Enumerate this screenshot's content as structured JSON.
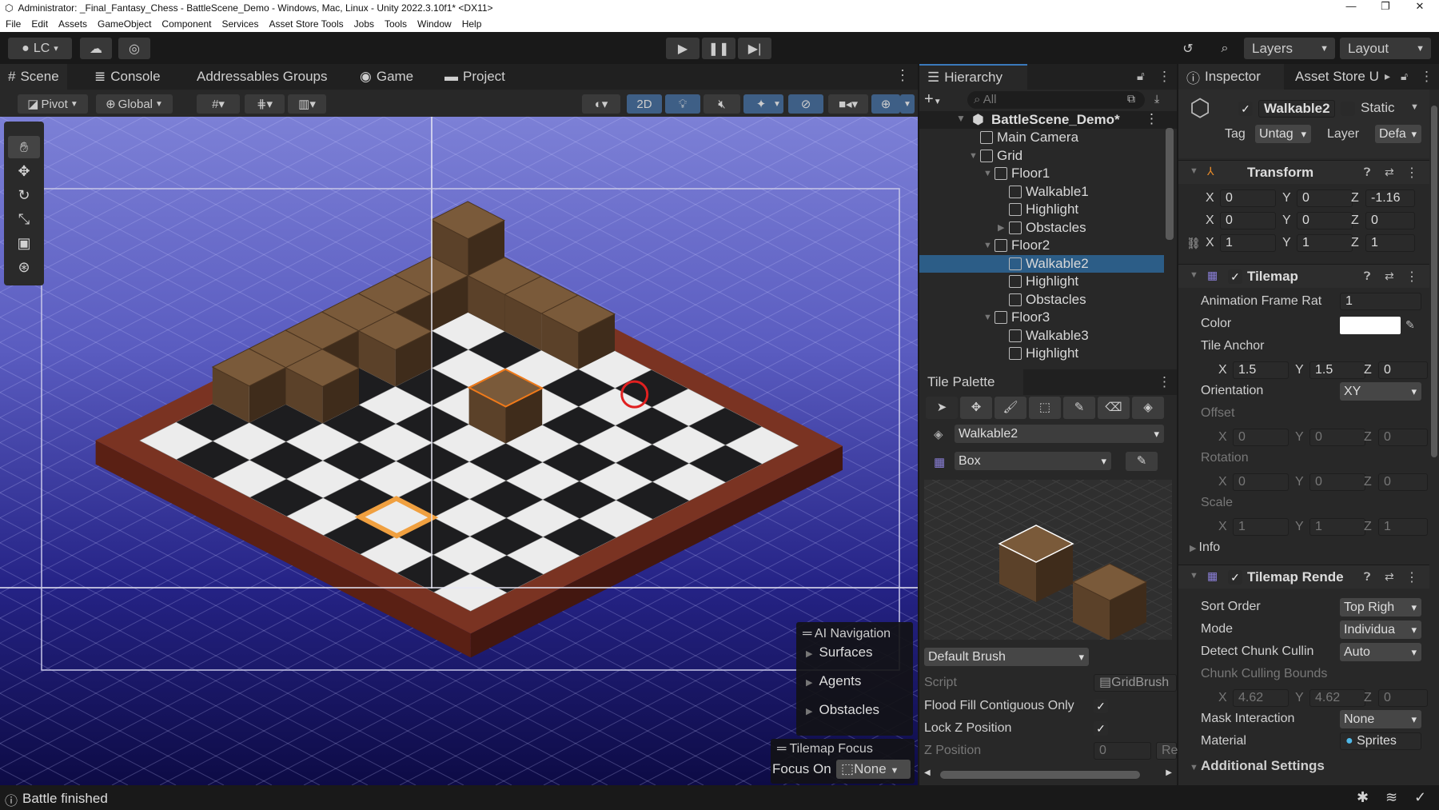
{
  "window": {
    "title": "Administrator: _Final_Fantasy_Chess - BattleScene_Demo - Windows, Mac, Linux - Unity 2022.3.10f1* <DX11>"
  },
  "menu": [
    "File",
    "Edit",
    "Assets",
    "GameObject",
    "Component",
    "Services",
    "Asset Store Tools",
    "Jobs",
    "Tools",
    "Window",
    "Help"
  ],
  "toolbar": {
    "account": "LC",
    "layers": "Layers",
    "layout": "Layout"
  },
  "scene_tabs": [
    {
      "label": "Scene",
      "icon": "#"
    },
    {
      "label": "Console",
      "icon": "≣"
    },
    {
      "label": "Addressables Groups",
      "icon": ""
    },
    {
      "label": "Game",
      "icon": "◉"
    },
    {
      "label": "Project",
      "icon": "▬"
    }
  ],
  "scene_toolbar": {
    "pivot": "Pivot",
    "global": "Global",
    "mode2d": "2D"
  },
  "overlays": {
    "ai_nav_title": "AI Navigation",
    "ai_nav_items": [
      "Surfaces",
      "Agents",
      "Obstacles"
    ],
    "focus_title": "Tilemap Focus",
    "focus_label": "Focus On",
    "focus_value": "None"
  },
  "hierarchy": {
    "title": "Hierarchy",
    "search_placeholder": "All",
    "scene": "BattleScene_Demo*",
    "items": [
      {
        "label": "Main Camera",
        "depth": 1,
        "arrow": ""
      },
      {
        "label": "Grid",
        "depth": 1,
        "arrow": "▼"
      },
      {
        "label": "Floor1",
        "depth": 2,
        "arrow": "▼"
      },
      {
        "label": "Walkable1",
        "depth": 3,
        "arrow": ""
      },
      {
        "label": "Highlight",
        "depth": 3,
        "arrow": ""
      },
      {
        "label": "Obstacles",
        "depth": 3,
        "arrow": "▶"
      },
      {
        "label": "Floor2",
        "depth": 2,
        "arrow": "▼"
      },
      {
        "label": "Walkable2",
        "depth": 3,
        "arrow": "",
        "selected": true
      },
      {
        "label": "Highlight",
        "depth": 3,
        "arrow": ""
      },
      {
        "label": "Obstacles",
        "depth": 3,
        "arrow": ""
      },
      {
        "label": "Floor3",
        "depth": 2,
        "arrow": "▼"
      },
      {
        "label": "Walkable3",
        "depth": 3,
        "arrow": ""
      },
      {
        "label": "Highlight",
        "depth": 3,
        "arrow": ""
      }
    ]
  },
  "tile_palette": {
    "title": "Tile Palette",
    "target": "Walkable2",
    "palette": "Box",
    "brush": "Default Brush",
    "script_label": "Script",
    "script_value": "GridBrush",
    "flood_fill": "Flood Fill Contiguous Only",
    "lock_z": "Lock Z Position",
    "z_position": "Z Position",
    "z_value": "0",
    "reset": "Re"
  },
  "inspector": {
    "tab": "Inspector",
    "tab2": "Asset Store U",
    "name": "Walkable2",
    "static": "Static",
    "tag_label": "Tag",
    "tag": "Untag",
    "layer_label": "Layer",
    "layer": "Defa",
    "transform": {
      "title": "Transform",
      "position": [
        "0",
        "0",
        "-1.16"
      ],
      "rotation": [
        "0",
        "0",
        "0"
      ],
      "scale": [
        "1",
        "1",
        "1"
      ]
    },
    "tilemap": {
      "title": "Tilemap",
      "anim_label": "Animation Frame Rat",
      "anim": "1",
      "color_label": "Color",
      "anchor_label": "Tile Anchor",
      "anchor": [
        "1.5",
        "1.5",
        "0"
      ],
      "orientation_label": "Orientation",
      "orientation": "XY",
      "offset_label": "Offset",
      "offset": [
        "0",
        "0",
        "0"
      ],
      "rotation_label": "Rotation",
      "rotation": [
        "0",
        "0",
        "0"
      ],
      "scale_label": "Scale",
      "scale": [
        "1",
        "1",
        "1"
      ],
      "info": "Info"
    },
    "renderer": {
      "title": "Tilemap Rende",
      "sort_label": "Sort Order",
      "sort": "Top Righ",
      "mode_label": "Mode",
      "mode": "Individua",
      "detect_label": "Detect Chunk Cullin",
      "detect": "Auto",
      "bounds_label": "Chunk Culling Bounds",
      "bounds": [
        "4.62",
        "4.62",
        "0"
      ],
      "mask_label": "Mask Interaction",
      "mask": "None",
      "material_label": "Material",
      "material": "Sprites",
      "additional": "Additional Settings"
    }
  },
  "status": {
    "message": "Battle finished"
  },
  "axes": [
    "X",
    "Y",
    "Z"
  ],
  "colors": {
    "accent": "#2c5d87",
    "highlight": "#f07a1a",
    "selected": "#2c5d87"
  }
}
